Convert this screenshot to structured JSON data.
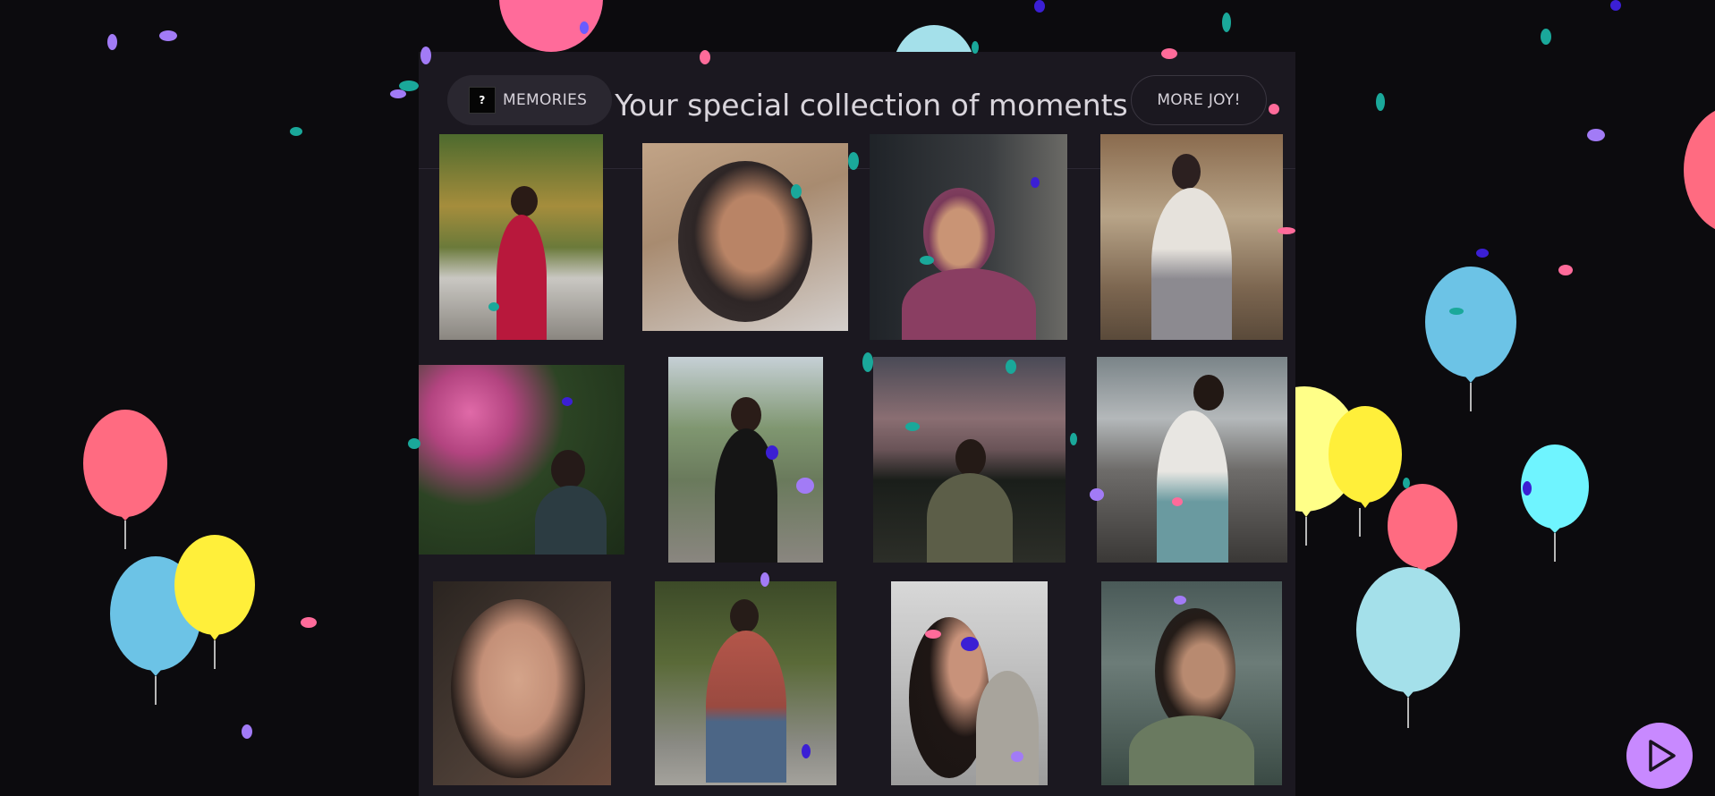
{
  "header": {
    "memories_label": "MEMORIES",
    "memories_icon": "?",
    "title": "Your special collection of moments",
    "more_joy_label": "MORE JOY!"
  },
  "colors": {
    "background": "#0c0b0e",
    "panel": "#1b1820",
    "accent_play": "#c889ff",
    "balloon_pink": "#ff6b81",
    "balloon_yellow": "#ffef3a",
    "balloon_blue": "#6cc3e6",
    "balloon_cyan": "#6ff4ff",
    "balloon_pale_blue": "#a4e0ea"
  },
  "gallery": {
    "photos": [
      {
        "name": "photo-bench-red-dress"
      },
      {
        "name": "photo-selfie-pout"
      },
      {
        "name": "photo-headscarf-portrait"
      },
      {
        "name": "photo-steps-sitting"
      },
      {
        "name": "photo-pink-flowers"
      },
      {
        "name": "photo-black-outfit"
      },
      {
        "name": "photo-sunset-sitting"
      },
      {
        "name": "photo-beach-rocks"
      },
      {
        "name": "photo-closeup-smile"
      },
      {
        "name": "photo-plaid-shirt"
      },
      {
        "name": "photo-looking-up"
      },
      {
        "name": "photo-rain-smile"
      }
    ]
  },
  "controls": {
    "play_icon": "play-icon"
  }
}
